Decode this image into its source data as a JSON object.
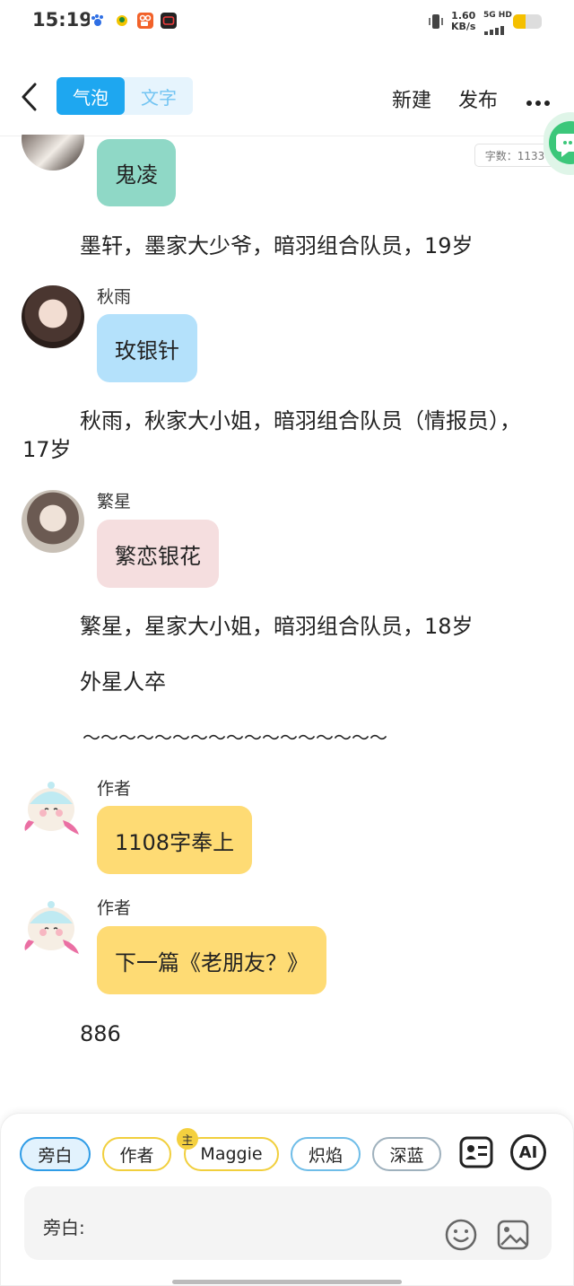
{
  "status_bar": {
    "time": "15:19",
    "net_speed_value": "1.60",
    "net_speed_unit": "KB/s",
    "net_type": "5G HD",
    "battery_level": 0.45,
    "icons": [
      "paw-app-icon",
      "bird-app-icon",
      "kuaishou-app-icon",
      "video-app-icon",
      "vibrate-icon",
      "signal-icon",
      "battery-icon"
    ]
  },
  "nav": {
    "segments": [
      {
        "label": "气泡",
        "active": true
      },
      {
        "label": "文字",
        "active": false
      }
    ],
    "new_label": "新建",
    "publish_label": "发布",
    "back_icon": "chevron-left-icon",
    "more_icon": "more-dots-icon"
  },
  "word_count": "字数：1133",
  "chat": {
    "top_bubble": "鬼凌",
    "narration_moxuan": "墨轩，墨家大少爷，暗羽组合队员，19岁",
    "qiuyu": {
      "name": "秋雨",
      "bubble": "玫银针",
      "color": "#b4e1fb"
    },
    "narration_qiuyu": "秋雨，秋家大小姐，暗羽组合队员（情报员），17岁",
    "fanxing": {
      "name": "繁星",
      "bubble": "繁恋银花",
      "color": "#f5dedf"
    },
    "narration_fanxing": "繁星，星家大小姐，暗羽组合队员，18岁",
    "narration_alien": "外星人卒",
    "separator": "～～～～～～～～～～～～～～～～～",
    "author1": {
      "name": "作者",
      "bubble": "1108字奉上",
      "color": "#fedb74"
    },
    "author2": {
      "name": "作者",
      "bubble": "下一篇《老朋友？》",
      "color": "#fedb74"
    },
    "narration_end": "886",
    "top_bubble_color": "#8fd8c6"
  },
  "panel": {
    "chips": [
      "旁白",
      "作者",
      "Maggie",
      "炽焰",
      "深蓝"
    ],
    "host_badge": "主",
    "ai_label": "AI",
    "input_label": "旁白:",
    "icons": [
      "character-card-icon",
      "ai-icon",
      "emoji-icon",
      "image-icon"
    ]
  }
}
